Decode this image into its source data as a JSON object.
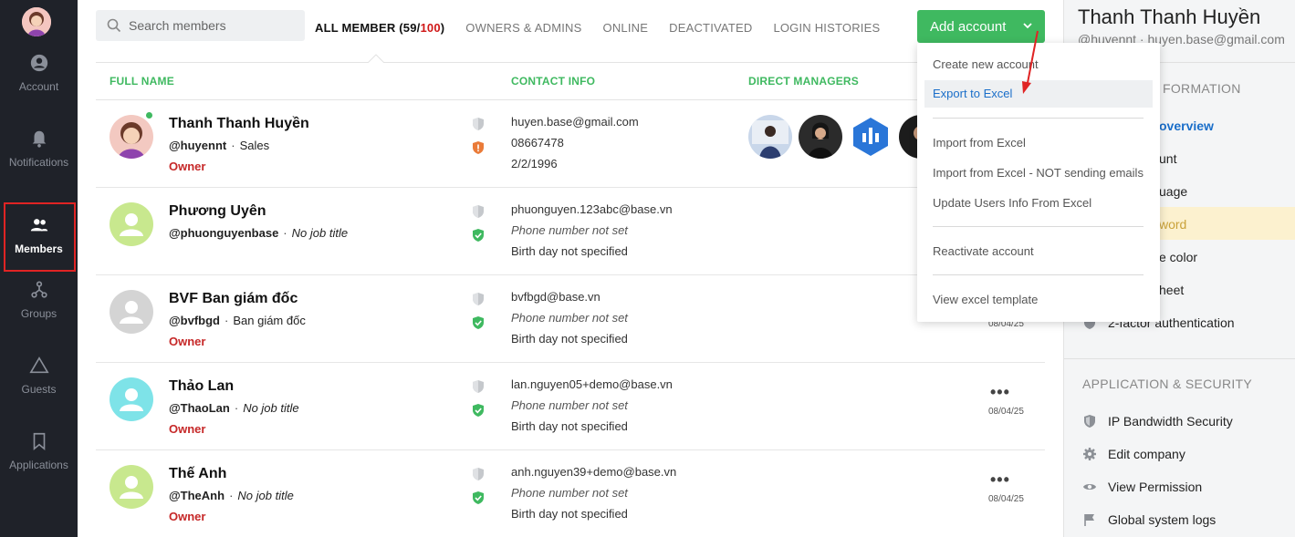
{
  "nav": {
    "items": [
      {
        "label": "Account",
        "icon": "account-circle-icon"
      },
      {
        "label": "Notifications",
        "icon": "bell-icon"
      },
      {
        "label": "Members",
        "icon": "members-icon"
      },
      {
        "label": "Groups",
        "icon": "groups-icon"
      },
      {
        "label": "Guests",
        "icon": "triangle-icon"
      },
      {
        "label": "Applications",
        "icon": "bookmark-icon"
      }
    ],
    "active": "Members"
  },
  "search": {
    "placeholder": "Search members"
  },
  "tabs": {
    "all_label": "ALL MEMBER (",
    "all_count": "59",
    "all_slash": "/",
    "all_max": "100",
    "all_close": ")",
    "owners": "OWNERS & ADMINS",
    "online": "ONLINE",
    "deactivated": "DEACTIVATED",
    "login": "LOGIN HISTORIES"
  },
  "add_button": {
    "label": "Add account"
  },
  "table": {
    "headers": {
      "name": "FULL NAME",
      "contact": "CONTACT INFO",
      "managers": "DIRECT MANAGERS"
    },
    "rows": [
      {
        "name": "Thanh Thanh Huyền",
        "handle": "@huyennt",
        "job": "Sales",
        "role": "Owner",
        "email": "huyen.base@gmail.com",
        "phone": "08667478",
        "birthday": "2/2/1996"
      },
      {
        "name": "Phương Uyên",
        "handle": "@phuonguyenbase",
        "job": "No job title",
        "role": "",
        "email": "phuonguyen.123abc@base.vn",
        "phone": "Phone number not set",
        "birthday": "Birth day not specified"
      },
      {
        "name": "BVF Ban giám đốc",
        "handle": "@bvfbgd",
        "job": "Ban giám đốc",
        "role": "Owner",
        "email": "bvfbgd@base.vn",
        "phone": "Phone number not set",
        "birthday": "Birth day not specified",
        "date": "08/04/25"
      },
      {
        "name": "Thảo Lan",
        "handle": "@ThaoLan",
        "job": "No job title",
        "role": "Owner",
        "email": "lan.nguyen05+demo@base.vn",
        "phone": "Phone number not set",
        "birthday": "Birth day not specified",
        "more": "•••",
        "date": "08/04/25"
      },
      {
        "name": "Thế Anh",
        "handle": "@TheAnh",
        "job": "No job title",
        "role": "Owner",
        "email": "anh.nguyen39+demo@base.vn",
        "phone": "Phone number not set",
        "birthday": "Birth day not specified",
        "more": "•••",
        "date": "08/04/25"
      }
    ]
  },
  "dropdown": {
    "items": [
      "Create new account",
      "Export to Excel",
      "Import from Excel",
      "Import from Excel - NOT sending emails",
      "Update Users Info From Excel",
      "Reactivate account",
      "View excel template"
    ]
  },
  "right_panel": {
    "name": "Thanh Thanh Huyền",
    "sub": "@huyennt · huyen.base@gmail.com",
    "section1": "FORMATION",
    "items1": [
      "overview",
      "unt",
      "uage",
      "word",
      "e color",
      "heet",
      "2-factor authentication"
    ],
    "section2": "APPLICATION & SECURITY",
    "items2": [
      "IP Bandwidth Security",
      "Edit company",
      "View Permission",
      "Global system logs"
    ]
  },
  "colors": {
    "accent": "#3fb960",
    "sidebar": "#1f2229",
    "highlight_border": "#e02424",
    "owner": "#c62828",
    "link": "#1a6ec9"
  }
}
